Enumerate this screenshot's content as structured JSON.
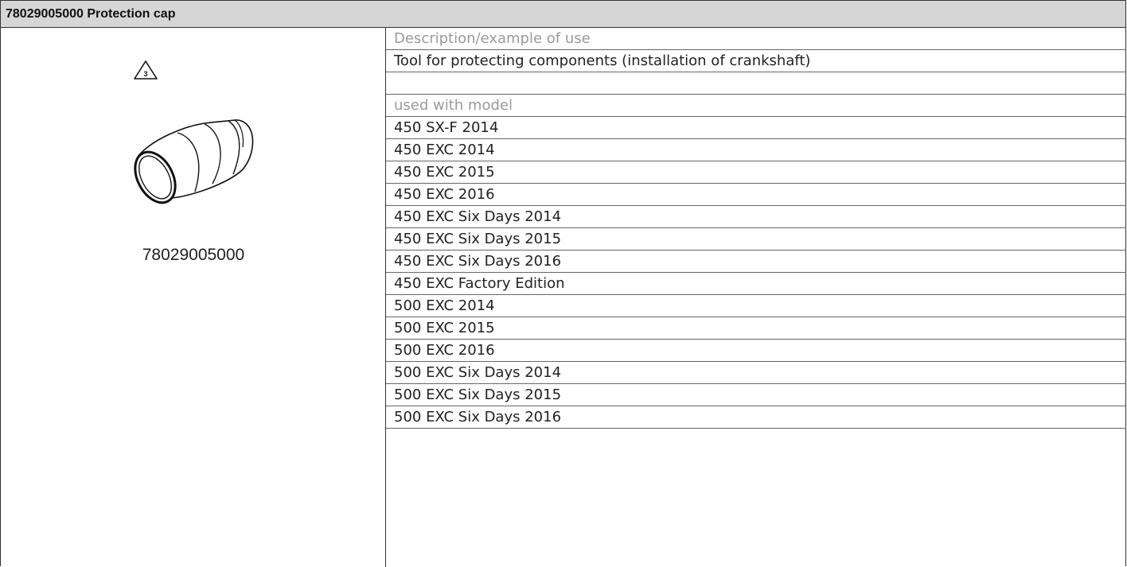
{
  "header": {
    "title": "78029005000 Protection cap"
  },
  "tool": {
    "warning_icon": "warning-triangle-3-icon",
    "warning_number": "3",
    "image_icon": "protection-cap-illustration",
    "part_number": "78029005000"
  },
  "details": {
    "description_caption": "Description/example of use",
    "description": "Tool for protecting components (installation of crankshaft)",
    "models_caption": "used with model",
    "models": [
      "450 SX-F 2014",
      "450 EXC 2014",
      "450 EXC 2015",
      "450 EXC 2016",
      "450 EXC Six Days 2014",
      "450 EXC Six Days 2015",
      "450 EXC Six Days 2016",
      "450 EXC Factory Edition",
      "500 EXC 2014",
      "500 EXC 2015",
      "500 EXC 2016",
      "500 EXC Six Days 2014",
      "500 EXC Six Days 2015",
      "500 EXC Six Days 2016"
    ]
  }
}
